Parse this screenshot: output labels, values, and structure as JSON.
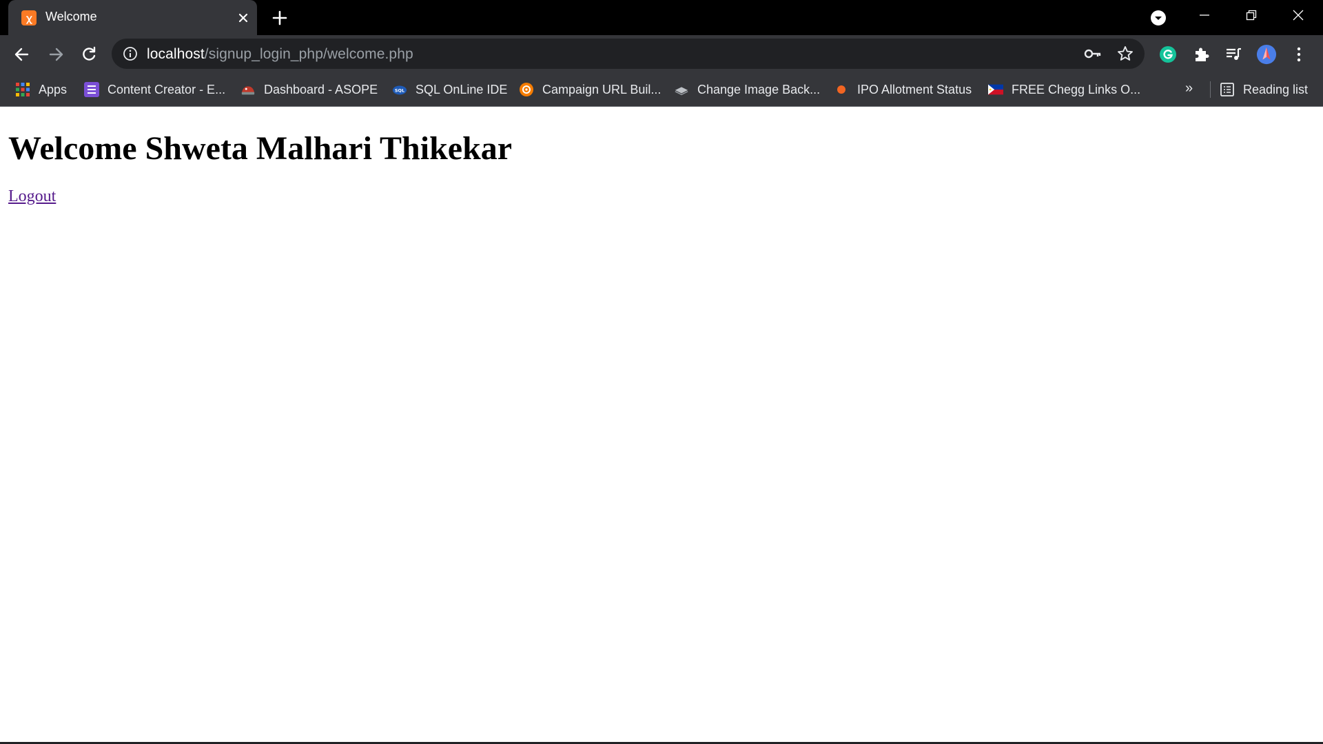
{
  "browser": {
    "tab": {
      "title": "Welcome",
      "favicon": "xampp-icon"
    },
    "address_bar": {
      "host": "localhost",
      "path": "/signup_login_php/welcome.php"
    },
    "bookmarks": [
      {
        "label": "Apps",
        "icon": "apps-grid-icon"
      },
      {
        "label": "Content Creator - E...",
        "icon": "content-creator-icon"
      },
      {
        "label": "Dashboard - ASOPE",
        "icon": "asope-icon"
      },
      {
        "label": "SQL OnLine IDE",
        "icon": "sql-icon"
      },
      {
        "label": "Campaign URL Buil...",
        "icon": "campaign-icon"
      },
      {
        "label": "Change Image Back...",
        "icon": "layers-icon"
      },
      {
        "label": "IPO Allotment Status",
        "icon": "orange-dot-icon"
      },
      {
        "label": "FREE Chegg Links O...",
        "icon": "flag-icon"
      }
    ],
    "more_bookmarks": "»",
    "reading_list": "Reading list"
  },
  "page": {
    "heading": "Welcome Shweta Malhari Thikekar",
    "logout_link": "Logout"
  },
  "colors": {
    "titlebar": "#000000",
    "toolbar": "#35363a",
    "omnibox": "#202124",
    "link_visited": "#551a8b"
  }
}
